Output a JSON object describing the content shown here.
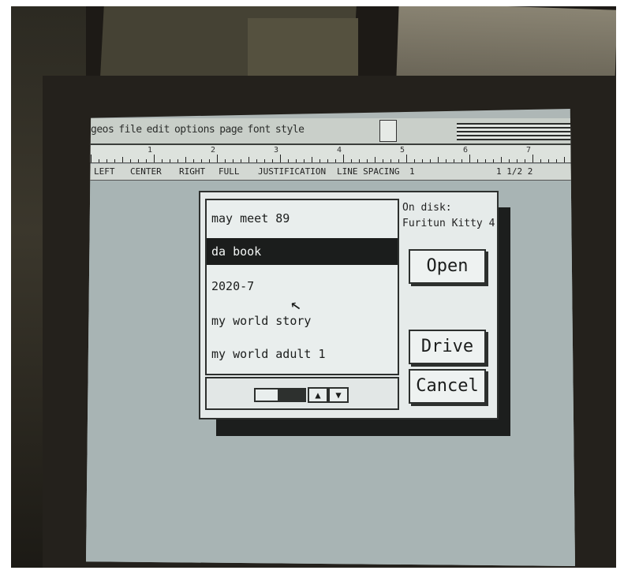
{
  "menubar": {
    "items": [
      "geos",
      "file",
      "edit",
      "options",
      "page",
      "font",
      "style"
    ]
  },
  "ruler": {
    "numbers": [
      "1",
      "2",
      "3",
      "4",
      "5",
      "6",
      "7"
    ]
  },
  "formatbar": {
    "left": "LEFT",
    "center": "CENTER",
    "right": "RIGHT",
    "full": "FULL",
    "justification": "JUSTIFICATION",
    "line_spacing": "LINE SPACING",
    "spacing_value": "1",
    "extra": "1 1/2 2"
  },
  "dialog": {
    "files": [
      {
        "name": "may meet 89",
        "selected": false
      },
      {
        "name": "da book",
        "selected": true
      },
      {
        "name": "2020-7",
        "selected": false
      },
      {
        "name": "my world story",
        "selected": false
      },
      {
        "name": "my world adult 1",
        "selected": false
      }
    ],
    "disk_prefix": "On disk:",
    "disk_name": "Furitun Kitty 4",
    "open_label": "Open",
    "drive_label": "Drive",
    "cancel_label": "Cancel",
    "scroll_up_symbol": "▲",
    "scroll_down_symbol": "▼"
  }
}
